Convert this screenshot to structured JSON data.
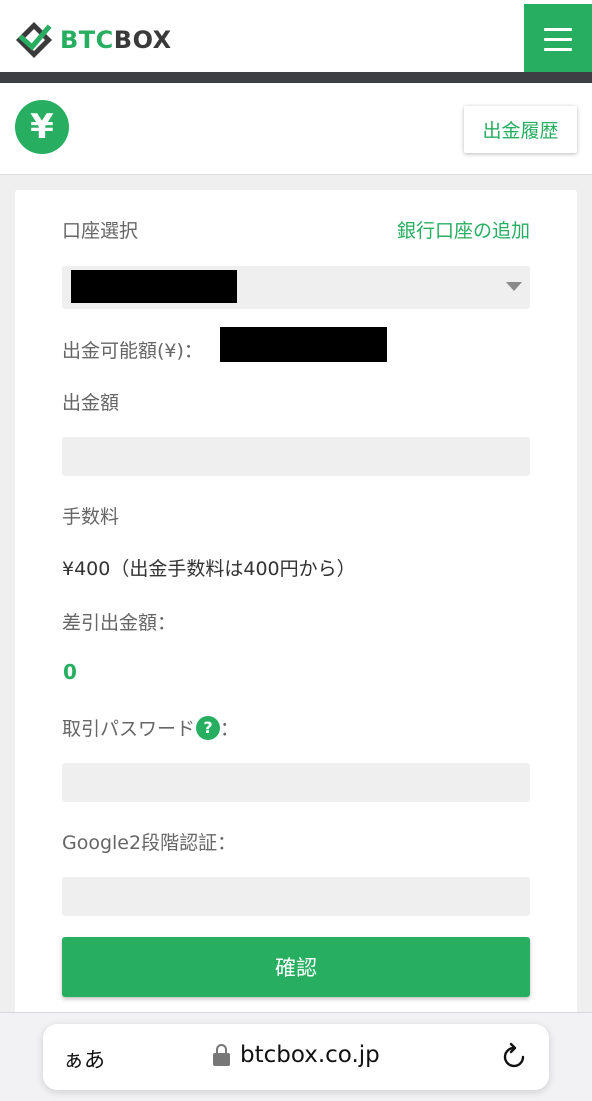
{
  "header": {
    "logo_part1": "BT",
    "logo_part2": "C",
    "logo_part3": "BOX",
    "menu_icon": "hamburger-icon"
  },
  "subheader": {
    "currency_symbol": "¥",
    "history_button": "出金履歴"
  },
  "form": {
    "account_select_label": "口座選択",
    "add_bank_link": "銀行口座の追加",
    "available_label": "出金可能額(¥)：",
    "amount_label": "出金額",
    "fee_label": "手数料",
    "fee_value": "¥400（出金手数料は400円から）",
    "net_amount_label": "差引出金額：",
    "net_amount_value": "0",
    "password_label": "取引パスワード",
    "password_help": "?",
    "password_colon": "：",
    "google_2fa_label": "Google2段階認証：",
    "confirm_button": "確認"
  },
  "browser": {
    "aa_label": "ぁあ",
    "url": "btcbox.co.jp",
    "lock_icon": "lock-icon",
    "reload_icon": "reload-icon"
  },
  "colors": {
    "accent": "#27ae60",
    "header_bar": "#3d3f45",
    "input_bg": "#efefef"
  }
}
